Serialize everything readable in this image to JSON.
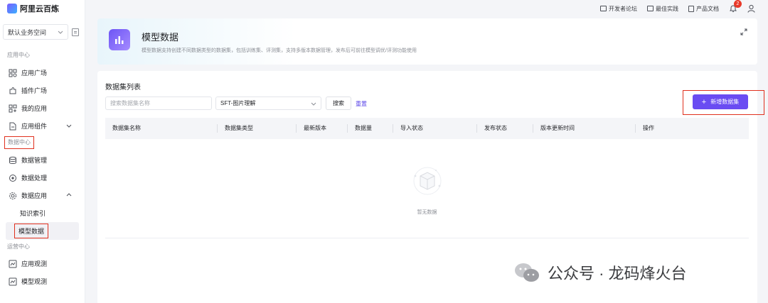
{
  "app": {
    "name": "阿里云百炼"
  },
  "sidebar": {
    "workspace": "默认业务空间",
    "sections": {
      "app_center": "应用中心",
      "data_center": "数据中心",
      "ops_center": "运营中心"
    },
    "app_items": [
      "应用广场",
      "插件广场",
      "我的应用",
      "应用组件"
    ],
    "data_items": [
      "数据管理",
      "数据处理",
      "数据应用"
    ],
    "data_sub_items": [
      "知识索引",
      "模型数据"
    ],
    "ops_items": [
      "应用观测",
      "模型观测"
    ]
  },
  "topbar": {
    "links": [
      "开发者论坛",
      "最佳实践",
      "产品文档"
    ],
    "notification_count": "2"
  },
  "header": {
    "title": "模型数据",
    "description": "模型数据支持创建不同数据类型的数据集，包括训练集、评测集，支持多版本数据管理，发布后可前往模型调优/评测功能使用"
  },
  "list": {
    "title": "数据集列表",
    "search_placeholder": "搜索数据集名称",
    "type_value": "SFT-图片理解",
    "search_label": "搜索",
    "reset_label": "重置",
    "add_label": "新增数据集",
    "columns": [
      "数据集名称",
      "数据集类型",
      "最新版本",
      "数据量",
      "导入状态",
      "发布状态",
      "版本更新时间",
      "操作"
    ],
    "empty_text": "暂无数据"
  },
  "watermark": {
    "text": "公众号 · 龙码烽火台"
  },
  "colors": {
    "accent": "#6a4cf2",
    "highlight_box": "#e0301e",
    "badge": "#e8392a"
  }
}
